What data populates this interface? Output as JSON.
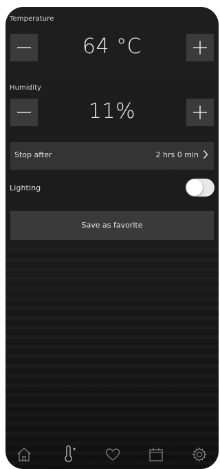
{
  "temperature": {
    "label": "Temperature",
    "value": "64 °C"
  },
  "humidity": {
    "label": "Humidity",
    "value": "11%"
  },
  "stop_after": {
    "label": "Stop after",
    "value": "2 hrs 0 min",
    "chevron": "›"
  },
  "lighting": {
    "label": "Lighting",
    "enabled": false
  },
  "favorite": {
    "label": "Save as favorite"
  },
  "tabs": [
    {
      "icon": "home-icon",
      "active": false
    },
    {
      "icon": "thermometer-icon",
      "active": true
    },
    {
      "icon": "heart-icon",
      "active": false
    },
    {
      "icon": "calendar-icon",
      "active": false
    },
    {
      "icon": "gear-icon",
      "active": false
    }
  ],
  "colors": {
    "background": "#1c1c1c",
    "button": "#3b3b3b",
    "text": "#e6e6e6",
    "tab_icon": "#8a8a8a",
    "tab_icon_active": "#d0d0d0"
  }
}
